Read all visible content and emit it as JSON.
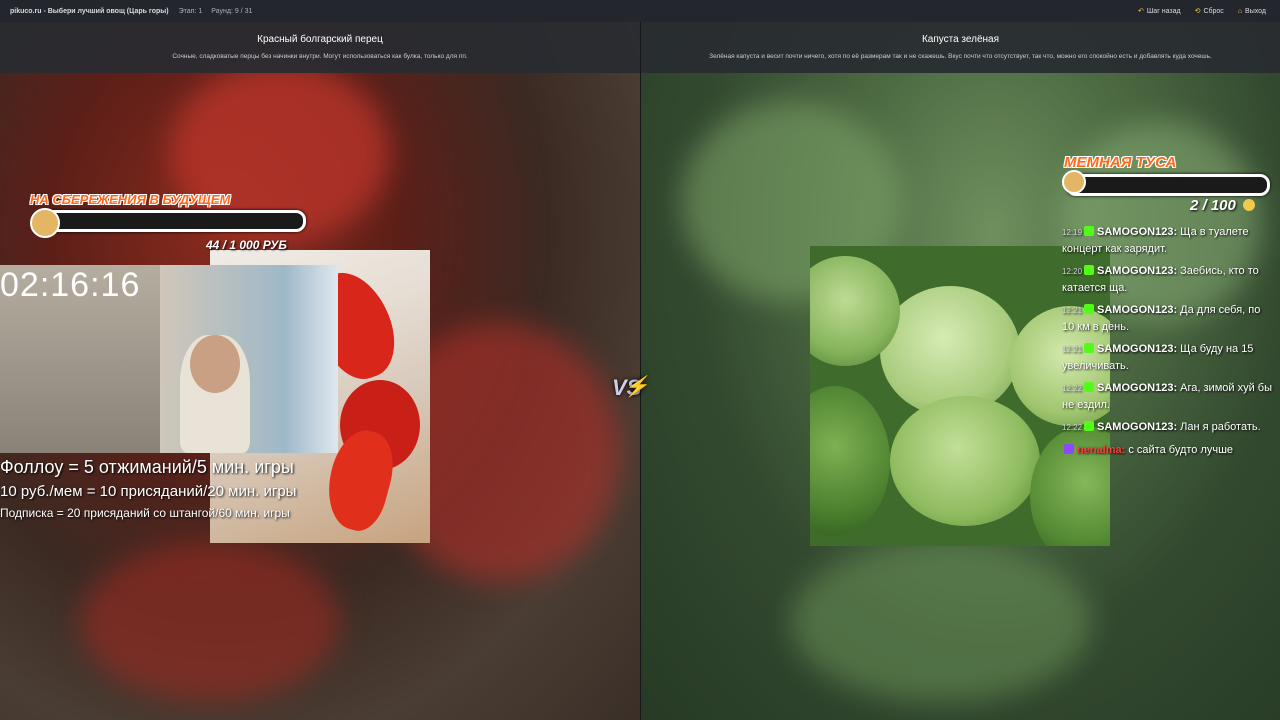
{
  "topbar": {
    "site": "pikuco.ru - Выбери лучший овощ (Царь горы)",
    "stage": "Этап: 1",
    "round": "Раунд: 9 / 31",
    "back_label": "Шаг назад",
    "reset_label": "Сброс",
    "exit_label": "Выход"
  },
  "left": {
    "title": "Красный болгарский перец",
    "description": "Сочные, сладковатые перцы без начинки внутри. Могут использоваться как булка, только для пп."
  },
  "right": {
    "title": "Капуста зелёная",
    "description": "Зелёная капуста и весит почти ничего, хотя по её размерам так и не скажешь. Вкус почти что отсутствует, так что, можно его спокойно есть и добавлять куда хочешь."
  },
  "vs_label": "VS",
  "overlay": {
    "timer": "02:16:16",
    "rule1": "Фоллоу = 5 отжиманий/5 мин. игры",
    "rule2": "10 руб./мем = 10 присяданий/20 мин. игры",
    "rule3": "Подписка = 20 присяданий со штангой/60 мин. игры",
    "savings_goal": {
      "title": "НА СБЕРЕЖЕНИЯ В БУДУЩЕМ",
      "count": "44 / 1 000 РУБ",
      "progress": 0.044
    },
    "meme_goal": {
      "title": "МЕМНАЯ ТУСА",
      "count": "2 / 100",
      "progress": 0.02
    }
  },
  "chat": [
    {
      "time": "12:19",
      "user": "SAMOGON123:",
      "text": "Ща в туалете концерт как зарядит.",
      "platform": "kick"
    },
    {
      "time": "12:20",
      "user": "SAMOGON123:",
      "text": "Заебись, кто то катается ща.",
      "platform": "kick"
    },
    {
      "time": "12:21",
      "user": "SAMOGON123:",
      "text": "Да для себя, по 10 км в день.",
      "platform": "kick"
    },
    {
      "time": "12:21",
      "user": "SAMOGON123:",
      "text": "Ща буду на 15 увеличивать.",
      "platform": "kick"
    },
    {
      "time": "12:22",
      "user": "SAMOGON123:",
      "text": "Ага, зимой хуй бы не ездил.",
      "platform": "kick"
    },
    {
      "time": "12:22",
      "user": "SAMOGON123:",
      "text": "Лан я работать.",
      "platform": "kick"
    },
    {
      "time": "",
      "user": "nenalma:",
      "text": "с сайта будто лучше",
      "platform": "twitch"
    }
  ],
  "colors": {
    "accent": "#f2c94c",
    "goal_orange": "#ff6a1a",
    "kick_green": "#53fc18",
    "twitch_purple": "#9146ff"
  }
}
